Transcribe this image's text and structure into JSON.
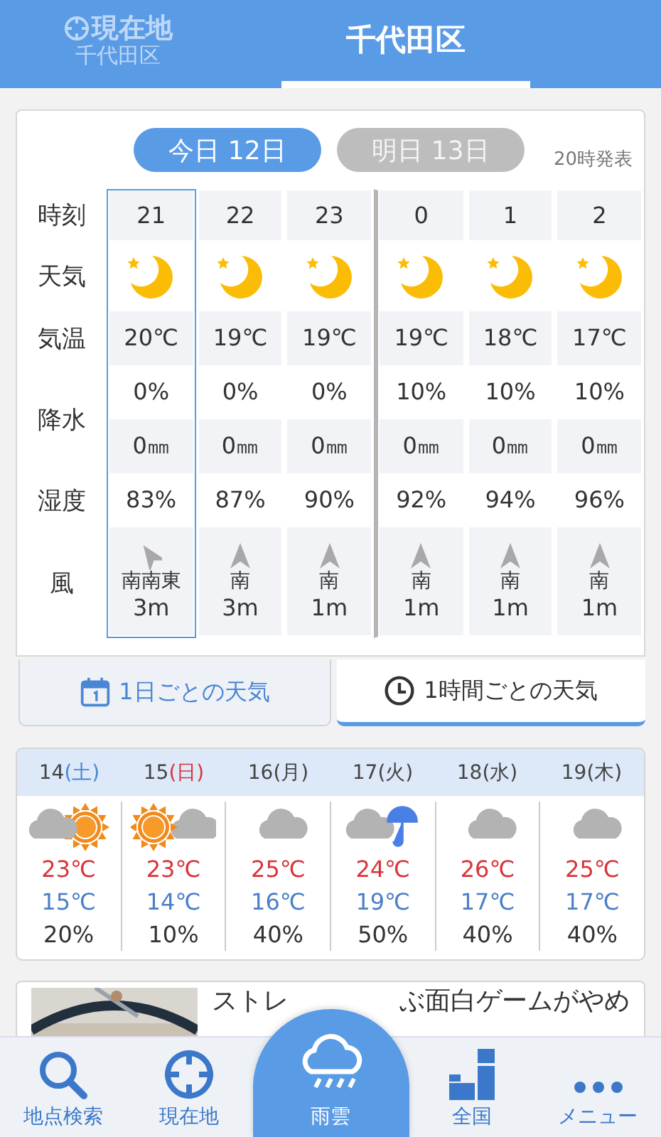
{
  "header": {
    "tabs": [
      {
        "label": "現在地",
        "sublabel": "千代田区",
        "selected": false
      },
      {
        "label": "千代田区",
        "selected": true
      }
    ]
  },
  "day_tabs": [
    {
      "label": "今日 12日",
      "selected": true
    },
    {
      "label": "明日 13日",
      "selected": false
    }
  ],
  "issued": "20時発表",
  "row_labels": {
    "time": "時刻",
    "weather": "天気",
    "temp": "気温",
    "precip": "降水",
    "humidity": "湿度",
    "wind": "風"
  },
  "hours": [
    {
      "time": "21",
      "selected": true,
      "day_start": false,
      "kind": "tilted",
      "temp": "20℃",
      "precip_prob": "0%",
      "precip_amount": "0㎜",
      "humidity": "83%",
      "wind_dir": "南南東",
      "wind_speed": "3m"
    },
    {
      "time": "22",
      "selected": false,
      "day_start": false,
      "kind": "up",
      "temp": "19℃",
      "precip_prob": "0%",
      "precip_amount": "0㎜",
      "humidity": "87%",
      "wind_dir": "南",
      "wind_speed": "3m"
    },
    {
      "time": "23",
      "selected": false,
      "day_start": false,
      "kind": "up",
      "temp": "19℃",
      "precip_prob": "0%",
      "precip_amount": "0㎜",
      "humidity": "90%",
      "wind_dir": "南",
      "wind_speed": "1m"
    },
    {
      "time": "0",
      "selected": false,
      "day_start": true,
      "kind": "up",
      "temp": "19℃",
      "precip_prob": "10%",
      "precip_amount": "0㎜",
      "humidity": "92%",
      "wind_dir": "南",
      "wind_speed": "1m"
    },
    {
      "time": "1",
      "selected": false,
      "day_start": false,
      "kind": "up",
      "temp": "18℃",
      "precip_prob": "10%",
      "precip_amount": "0㎜",
      "humidity": "94%",
      "wind_dir": "南",
      "wind_speed": "1m"
    },
    {
      "time": "2",
      "selected": false,
      "day_start": false,
      "kind": "up",
      "temp": "17℃",
      "precip_prob": "10%",
      "precip_amount": "0㎜",
      "humidity": "96%",
      "wind_dir": "南",
      "wind_speed": "1m"
    }
  ],
  "view_tabs": [
    {
      "label": "1日ごとの天気",
      "selected": false
    },
    {
      "label": "1時間ごとの天気",
      "selected": true
    }
  ],
  "daily": [
    {
      "date": "14",
      "weekday": "(土)",
      "color": "#4a86d3",
      "kind": "cloudy_sunny",
      "high": "23℃",
      "low": "15℃",
      "precip": "20%"
    },
    {
      "date": "15",
      "weekday": "(日)",
      "color": "#d9343a",
      "kind": "sunny_cloudy",
      "high": "23℃",
      "low": "14℃",
      "precip": "10%"
    },
    {
      "date": "16",
      "weekday": "(月)",
      "color": "#444444",
      "kind": "cloudy",
      "high": "25℃",
      "low": "16℃",
      "precip": "40%"
    },
    {
      "date": "17",
      "weekday": "(火)",
      "color": "#444444",
      "kind": "cloudy_rain",
      "high": "24℃",
      "low": "19℃",
      "precip": "50%"
    },
    {
      "date": "18",
      "weekday": "(水)",
      "color": "#444444",
      "kind": "cloudy",
      "high": "26℃",
      "low": "17℃",
      "precip": "40%"
    },
    {
      "date": "19",
      "weekday": "(木)",
      "color": "#444444",
      "kind": "cloudy",
      "high": "25℃",
      "low": "17℃",
      "precip": "40%"
    }
  ],
  "ad": {
    "kind": "picture",
    "text_parts": [
      "ストレ",
      "ぶ面白ゲームがやめ"
    ]
  },
  "nav": [
    {
      "label": "地点検索",
      "kind": "normal"
    },
    {
      "label": "現在地",
      "kind": "normal"
    },
    {
      "label": "雨雲",
      "kind": "center"
    },
    {
      "label": "全国",
      "kind": "normal"
    },
    {
      "label": "メニュー",
      "kind": "normal"
    }
  ]
}
